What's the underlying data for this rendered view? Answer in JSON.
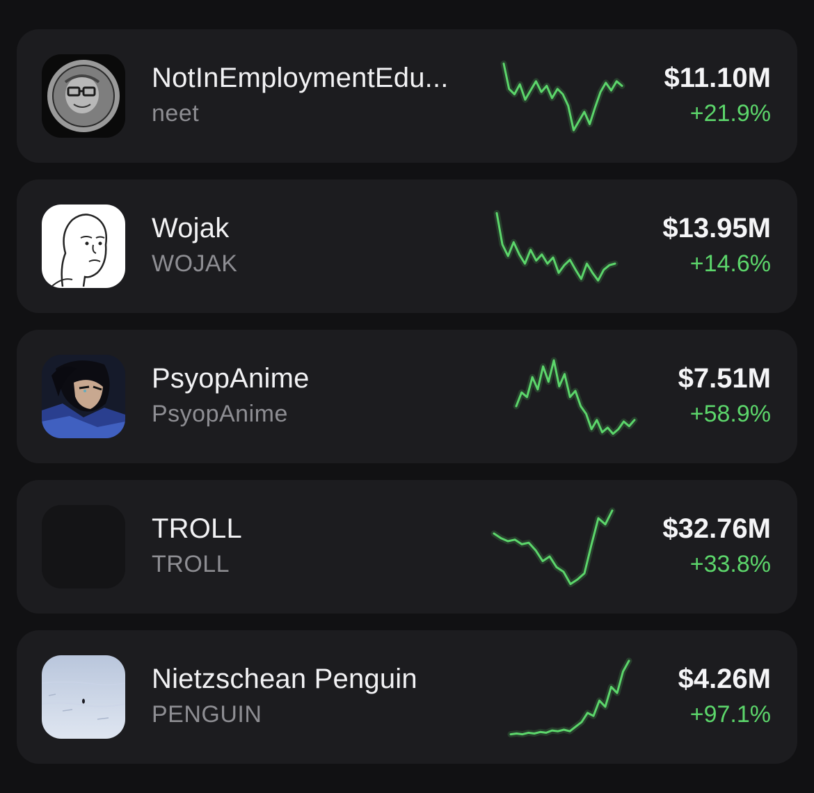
{
  "accent_color": "#5cd66b",
  "tokens": [
    {
      "name": "NotInEmploymentEdu...",
      "ticker": "neet",
      "market_cap": "$11.10M",
      "change": "+21.9%",
      "icon": "neet-avatar-icon",
      "sparkline": [
        0.95,
        0.62,
        0.55,
        0.68,
        0.48,
        0.6,
        0.72,
        0.58,
        0.66,
        0.5,
        0.62,
        0.55,
        0.4,
        0.08,
        0.2,
        0.32,
        0.16,
        0.38,
        0.58,
        0.7,
        0.6,
        0.72,
        0.66
      ]
    },
    {
      "name": "Wojak",
      "ticker": "WOJAK",
      "market_cap": "$13.95M",
      "change": "+14.6%",
      "icon": "wojak-avatar-icon",
      "sparkline": [
        0.96,
        0.55,
        0.4,
        0.58,
        0.42,
        0.3,
        0.48,
        0.34,
        0.42,
        0.3,
        0.38,
        0.18,
        0.28,
        0.35,
        0.22,
        0.1,
        0.3,
        0.18,
        0.08,
        0.22,
        0.28,
        0.3
      ]
    },
    {
      "name": "PsyopAnime",
      "ticker": "PsyopAnime",
      "market_cap": "$7.51M",
      "change": "+58.9%",
      "icon": "anime-avatar-icon",
      "sparkline": [
        0.4,
        0.58,
        0.52,
        0.78,
        0.62,
        0.92,
        0.72,
        1.0,
        0.66,
        0.82,
        0.52,
        0.6,
        0.4,
        0.3,
        0.1,
        0.22,
        0.06,
        0.12,
        0.04,
        0.1,
        0.2,
        0.14,
        0.22
      ]
    },
    {
      "name": "TROLL",
      "ticker": "TROLL",
      "market_cap": "$32.76M",
      "change": "+33.8%",
      "icon": "troll-avatar-icon",
      "sparkline": [
        0.7,
        0.64,
        0.6,
        0.62,
        0.56,
        0.58,
        0.48,
        0.34,
        0.4,
        0.26,
        0.2,
        0.04,
        0.1,
        0.18,
        0.55,
        0.9,
        0.82,
        1.0
      ]
    },
    {
      "name": "Nietzschean Penguin",
      "ticker": "PENGUIN",
      "market_cap": "$4.26M",
      "change": "+97.1%",
      "icon": "penguin-avatar-icon",
      "sparkline": [
        0.04,
        0.05,
        0.04,
        0.06,
        0.05,
        0.07,
        0.06,
        0.09,
        0.08,
        0.1,
        0.08,
        0.14,
        0.2,
        0.32,
        0.28,
        0.48,
        0.4,
        0.66,
        0.58,
        0.86,
        1.0
      ]
    }
  ]
}
